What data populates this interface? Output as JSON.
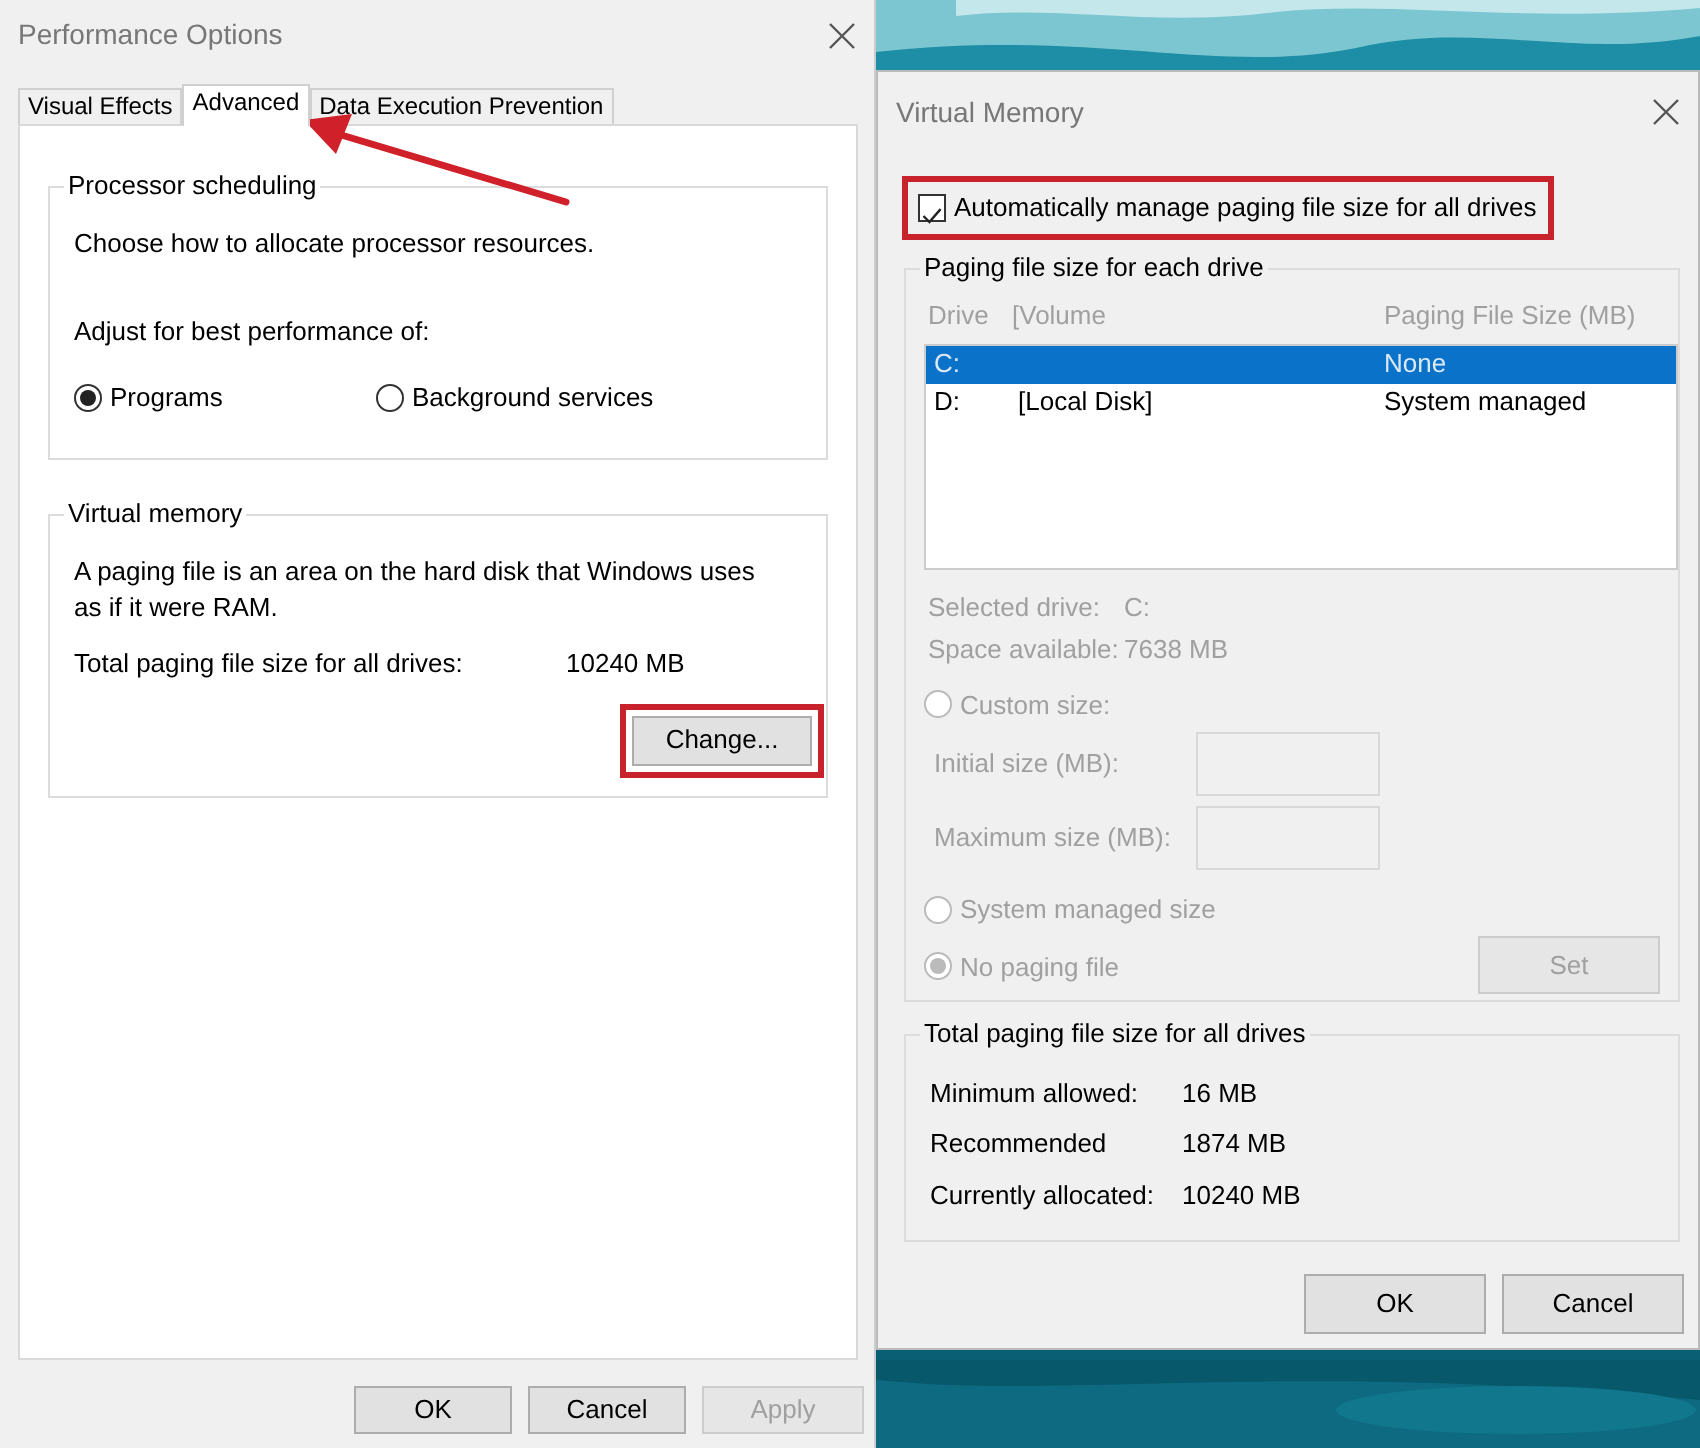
{
  "performance_options": {
    "title": "Performance Options",
    "tabs": [
      {
        "label": "Visual Effects",
        "selected": false,
        "pointed": false
      },
      {
        "label": "Advanced",
        "selected": true,
        "pointed": true
      },
      {
        "label": "Data Execution Prevention",
        "selected": false,
        "pointed": false
      }
    ],
    "processor_scheduling": {
      "title": "Processor scheduling",
      "description": "Choose how to allocate processor resources.",
      "adjust_label": "Adjust for best performance of:",
      "options": [
        {
          "label": "Programs",
          "selected": true
        },
        {
          "label": "Background services",
          "selected": false
        }
      ]
    },
    "virtual_memory": {
      "title": "Virtual memory",
      "description": "A paging file is an area on the hard disk that Windows uses as if it were RAM.",
      "total_label": "Total paging file size for all drives:",
      "total_value": "10240 MB",
      "change_button": {
        "label": "Change...",
        "highlighted": true
      }
    },
    "buttons": [
      {
        "label": "OK",
        "disabled": false
      },
      {
        "label": "Cancel",
        "disabled": false
      },
      {
        "label": "Apply",
        "disabled": true
      }
    ]
  },
  "virtual_memory_dialog": {
    "title": "Virtual Memory",
    "auto_manage": {
      "label": "Automatically manage paging file size for all drives",
      "checked": true,
      "highlighted": true
    },
    "drive_group": {
      "title": "Paging file size for each drive",
      "disabled": true,
      "columns": [
        "Drive",
        "[Volume",
        "Paging File Size (MB)"
      ],
      "rows": [
        {
          "drive": "C:",
          "size": "None",
          "selected": true
        },
        {
          "drive": "D:",
          "volume": "[Local Disk]",
          "size": "System managed",
          "selected": false
        }
      ],
      "info": [
        {
          "label": "Selected drive:",
          "value": "C:"
        },
        {
          "label": "Space available:",
          "value": "7638 MB"
        }
      ],
      "custom_option": {
        "label": "Custom size:",
        "selected": false
      },
      "fields": [
        {
          "label": "Initial size (MB):"
        },
        {
          "label": "Maximum size (MB):"
        }
      ],
      "other_options": [
        {
          "label": "System managed size",
          "selected": false
        },
        {
          "label": "No paging file",
          "selected": true
        }
      ],
      "set_button": {
        "label": "Set"
      }
    },
    "total_group": {
      "title": "Total paging file size for all drives",
      "rows": [
        {
          "label": "Minimum allowed:",
          "value": "16 MB"
        },
        {
          "label": "Recommended",
          "value": "1874 MB"
        },
        {
          "label": "Currently allocated:",
          "value": "10240 MB"
        }
      ]
    },
    "buttons": [
      {
        "label": "OK"
      },
      {
        "label": "Cancel"
      }
    ]
  }
}
